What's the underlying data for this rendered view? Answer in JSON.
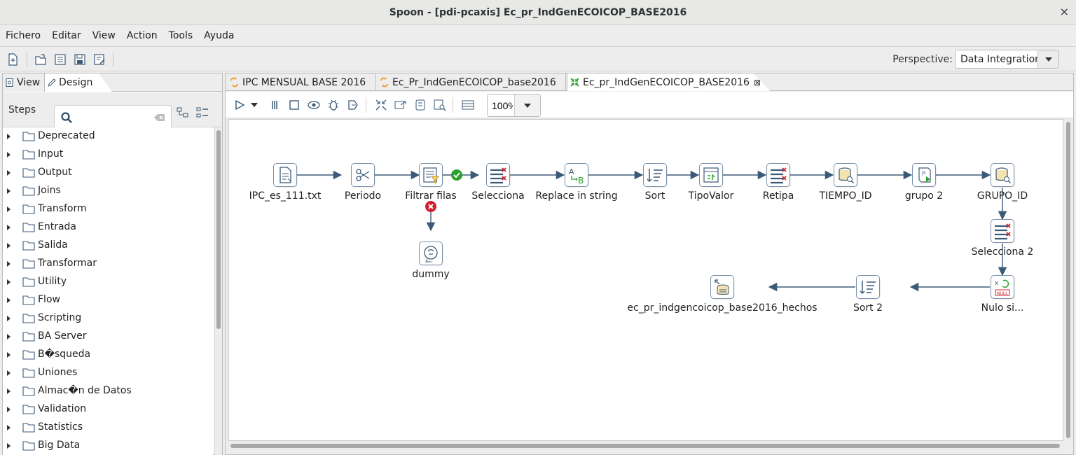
{
  "window": {
    "title": "Spoon - [pdi-pcaxis] Ec_pr_IndGenECOICOP_BASE2016",
    "close_glyph": "×"
  },
  "menu": [
    "Fichero",
    "Editar",
    "View",
    "Action",
    "Tools",
    "Ayuda"
  ],
  "main_toolbar": {
    "icons": [
      "new-file-icon",
      "open-file-icon",
      "explore-repository-icon",
      "save-icon",
      "save-as-icon"
    ],
    "perspective_label": "Perspective:",
    "perspective_value": "Data Integration"
  },
  "left_panel": {
    "tabs": {
      "view": "View",
      "design": "Design"
    },
    "steps_label": "Steps",
    "search": {
      "value": "",
      "placeholder": ""
    },
    "categories": [
      "Deprecated",
      "Input",
      "Output",
      "Joins",
      "Transform",
      "Entrada",
      "Salida",
      "Transformar",
      "Utility",
      "Flow",
      "Scripting",
      "BA Server",
      "B�squeda",
      "Uniones",
      "Almac�n de Datos",
      "Validation",
      "Statistics",
      "Big Data"
    ]
  },
  "doc_tabs": [
    {
      "label": "IPC MENSUAL BASE 2016",
      "icon": "job-icon"
    },
    {
      "label": "Ec_Pr_IndGenECOICOP_base2016",
      "icon": "job-icon"
    },
    {
      "label": "Ec_pr_IndGenECOICOP_BASE2016",
      "icon": "transformation-icon",
      "active": true,
      "close": "⊠"
    }
  ],
  "canvas_toolbar": {
    "zoom": "100%"
  },
  "steps": {
    "ipc": "IPC_es_111.txt",
    "periodo": "Periodo",
    "filtrar": "Filtrar filas",
    "selecciona": "Selecciona",
    "replace": "Replace in string",
    "sort": "Sort",
    "tipovalor": "TipoValor",
    "retipa": "Retipa",
    "tiempo": "TIEMPO_ID",
    "grupo2": "grupo 2",
    "grupoid": "GRUPO_ID",
    "selecciona2": "Selecciona 2",
    "nulo": "Nulo si...",
    "sort2": "Sort 2",
    "hechos": "ec_pr_indgencoicop_base2016_hechos",
    "dummy": "dummy"
  },
  "colors": {
    "hop": "#3c5a78",
    "node_border": "#7a92ad",
    "true_badge": "#2ba02b",
    "false_badge": "#d0202e",
    "job_icon": "#f0a030",
    "trans_icon": "#3aa03a"
  }
}
